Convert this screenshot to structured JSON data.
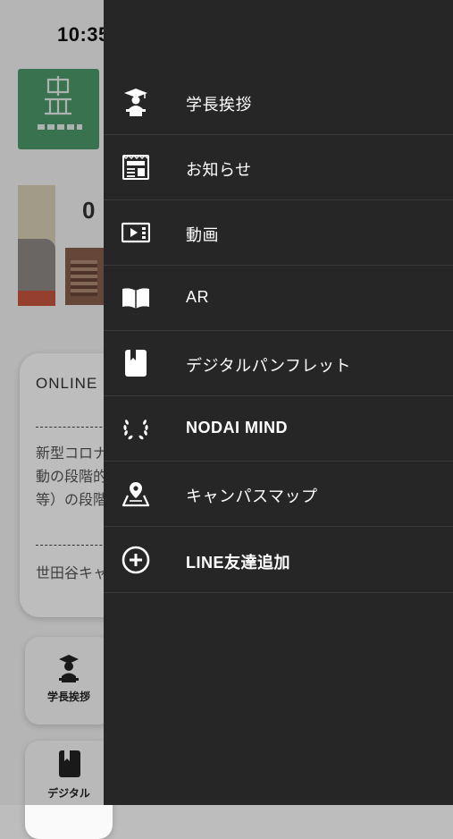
{
  "status_bar": {
    "time": "10:35",
    "icons": [
      "signal-icon",
      "wifi-icon",
      "battery-icon"
    ]
  },
  "background": {
    "logo_icon": "university-logo",
    "banner_date_fragment": "0",
    "online_card": {
      "title": "ONLINE N",
      "body_lines": [
        "新型コロナ",
        "動の段階的",
        "等）の段階"
      ],
      "sub": "世田谷キャ"
    },
    "tiles": [
      {
        "label": "学長挨拶",
        "icon": "graduate-icon"
      },
      {
        "label": "デジタル",
        "icon": "pamphlet-icon"
      }
    ]
  },
  "drawer": {
    "background": "#262626",
    "text_color": "#ffffff",
    "items": [
      {
        "label": "学長挨拶",
        "icon": "graduate-icon"
      },
      {
        "label": "お知らせ",
        "icon": "news-icon"
      },
      {
        "label": "動画",
        "icon": "video-icon"
      },
      {
        "label": "AR",
        "icon": "book-icon"
      },
      {
        "label": "デジタルパンフレット",
        "icon": "pamphlet-icon"
      },
      {
        "label": "NODAI MIND",
        "icon": "laurel-icon"
      },
      {
        "label": "キャンパスマップ",
        "icon": "map-pin-icon"
      },
      {
        "label": "LINE友達追加",
        "icon": "plus-circle-icon"
      }
    ]
  }
}
